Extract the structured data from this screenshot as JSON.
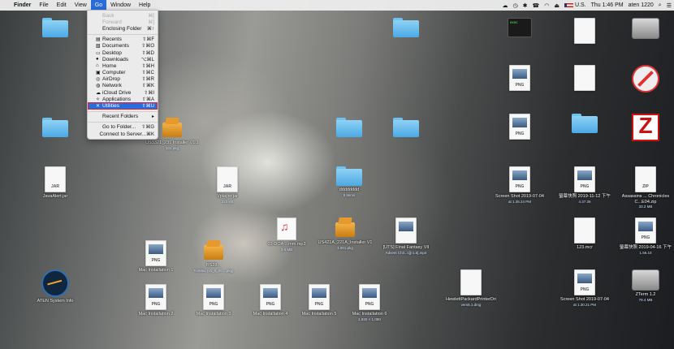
{
  "menubar": {
    "apple": "",
    "app": "Finder",
    "items": [
      "File",
      "Edit",
      "View",
      "Go",
      "Window",
      "Help"
    ],
    "right": {
      "input": "U.S.",
      "clock": "Thu 1:46 PM",
      "user": "aten 1220"
    }
  },
  "go_menu": {
    "items": [
      {
        "label": "Back",
        "shortcut": "⌘[",
        "disabled": true,
        "icon": ""
      },
      {
        "label": "Forward",
        "shortcut": "⌘]",
        "disabled": true,
        "icon": ""
      },
      {
        "label": "Enclosing Folder",
        "shortcut": "⌘↑",
        "disabled": false,
        "icon": ""
      },
      {
        "sep": true
      },
      {
        "label": "Recents",
        "shortcut": "⇧⌘F",
        "icon": "▤"
      },
      {
        "label": "Documents",
        "shortcut": "⇧⌘O",
        "icon": "▧"
      },
      {
        "label": "Desktop",
        "shortcut": "⇧⌘D",
        "icon": "▭"
      },
      {
        "label": "Downloads",
        "shortcut": "⌥⌘L",
        "icon": "●"
      },
      {
        "label": "Home",
        "shortcut": "⇧⌘H",
        "icon": "⌂"
      },
      {
        "label": "Computer",
        "shortcut": "⇧⌘C",
        "icon": "▣"
      },
      {
        "label": "AirDrop",
        "shortcut": "⇧⌘R",
        "icon": "◎"
      },
      {
        "label": "Network",
        "shortcut": "⇧⌘K",
        "icon": "◍"
      },
      {
        "label": "iCloud Drive",
        "shortcut": "⇧⌘I",
        "icon": "☁"
      },
      {
        "label": "Applications",
        "shortcut": "⇧⌘A",
        "icon": "✧"
      },
      {
        "label": "Utilities",
        "shortcut": "⇧⌘U",
        "icon": "✕",
        "selected": true
      },
      {
        "sep": true
      },
      {
        "label": "Recent Folders",
        "shortcut": "▸",
        "icon": ""
      },
      {
        "sep": true
      },
      {
        "label": "Go to Folder...",
        "shortcut": "⇧⌘G",
        "icon": ""
      },
      {
        "label": "Connect to Server...",
        "shortcut": "⌘K",
        "icon": ""
      }
    ]
  },
  "desktop": {
    "icons": [
      {
        "kind": "folder",
        "label": "",
        "sub": ""
      },
      {
        "kind": "folder",
        "label": "",
        "sub": ""
      },
      {
        "kind": "jar",
        "label": "JavaAlert.jar",
        "sub": ""
      },
      {
        "kind": "circle",
        "label": "ATEN System Info",
        "sub": ""
      },
      {
        "kind": "pkg",
        "label": "US3321_231 Installer V1.1",
        "sub": "101.pkg"
      },
      {
        "kind": "jar",
        "label": "Vplayer.jar",
        "sub": "323 KB"
      },
      {
        "kind": "music",
        "label": "03-DOA ...mm.mp3",
        "sub": "3.6 MB"
      },
      {
        "kind": "pkg",
        "label": "US421A_221A_Installer V1",
        "sub": "1.001.pkg"
      },
      {
        "kind": "video",
        "label": "[UTS] Final Fantasy VII",
        "sub": "Advent Chil...1][r1.5].mp4"
      },
      {
        "kind": "pkg",
        "label": "BS28...",
        "sub": "ForMac (v1_0_00 ...pkg)"
      },
      {
        "kind": "png",
        "label": "Mac Installation 1",
        "sub": ""
      },
      {
        "kind": "png",
        "label": "Mac Installation 2",
        "sub": ""
      },
      {
        "kind": "png",
        "label": "Mac Installation 3",
        "sub": ""
      },
      {
        "kind": "png",
        "label": "Mac Installation 4",
        "sub": ""
      },
      {
        "kind": "png",
        "label": "Mac Installation 5",
        "sub": ""
      },
      {
        "kind": "png",
        "label": "Mac Installation 6",
        "sub": "1,920 × 1,080"
      },
      {
        "kind": "folder",
        "label": "",
        "sub": ""
      },
      {
        "kind": "folder",
        "label": "",
        "sub": ""
      },
      {
        "kind": "folder",
        "label": "dddddddd",
        "sub": "8 items"
      },
      {
        "kind": "folder",
        "label": "",
        "sub": ""
      },
      {
        "kind": "term",
        "label": "",
        "sub": ""
      },
      {
        "kind": "doc",
        "label": "",
        "sub": ""
      },
      {
        "kind": "disk",
        "label": "",
        "sub": ""
      },
      {
        "kind": "png",
        "label": "",
        "sub": ""
      },
      {
        "kind": "doc",
        "label": "",
        "sub": ""
      },
      {
        "kind": "noentry",
        "label": "",
        "sub": ""
      },
      {
        "kind": "png",
        "label": "",
        "sub": ""
      },
      {
        "kind": "folder",
        "label": "",
        "sub": ""
      },
      {
        "kind": "zterm",
        "label": "",
        "sub": ""
      },
      {
        "kind": "png",
        "label": "Screen Shot 2019-07-04",
        "sub": "at 1.35.24 PM"
      },
      {
        "kind": "png",
        "label": "螢幕快照 2019-11-12 下午",
        "sub": "4.37.26"
      },
      {
        "kind": "zip",
        "label": "Assassins ... Chronicles C...E04.zip",
        "sub": "33.2 MB"
      },
      {
        "kind": "doc",
        "label": "123.mcr",
        "sub": ""
      },
      {
        "kind": "png",
        "label": "螢幕快照 2019-04-16 下午",
        "sub": "1.56.10"
      },
      {
        "kind": "doc",
        "label": "HewlettPackardPrinterDri",
        "sub": "vers5.1.dmg"
      },
      {
        "kind": "png",
        "label": "Screen Shot 2019-07-04",
        "sub": "at 1.30.21 PM"
      },
      {
        "kind": "disk",
        "label": "ZTerm 1.2",
        "sub": "78.4 MB"
      }
    ]
  }
}
